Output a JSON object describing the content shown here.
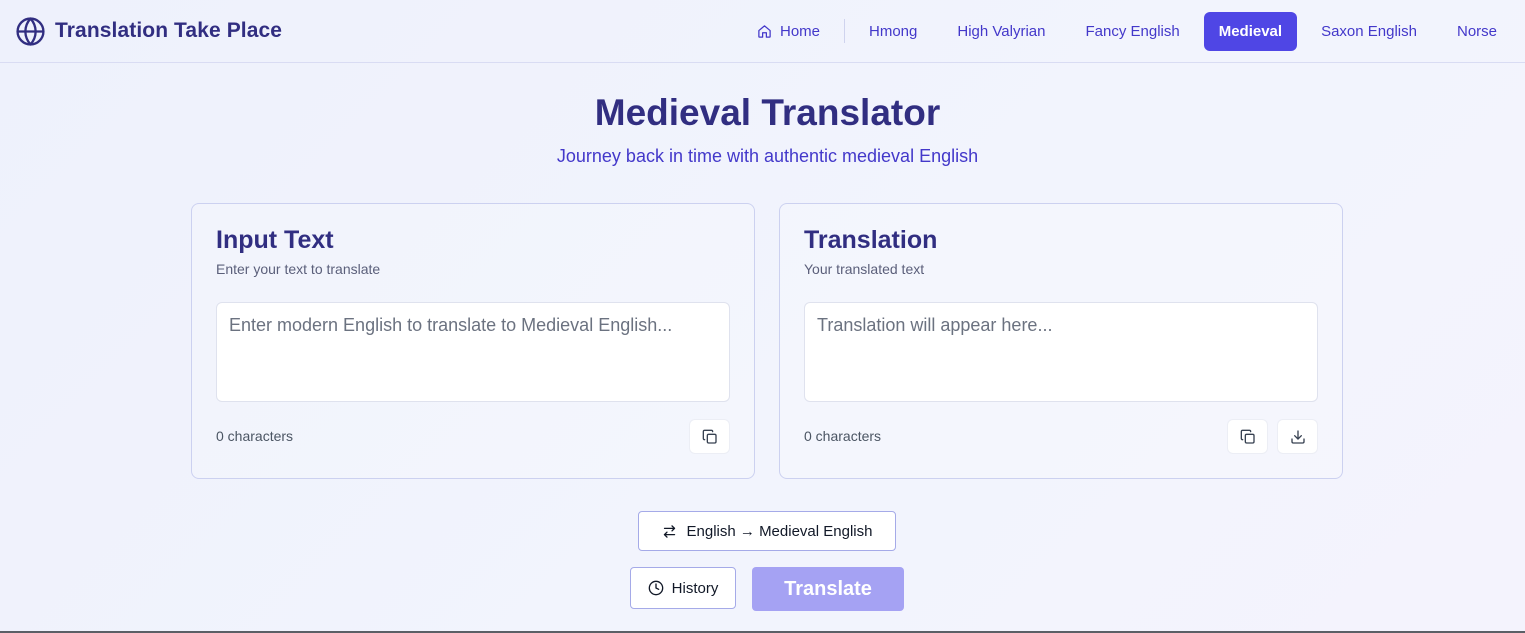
{
  "brand": {
    "title": "Translation Take Place",
    "icon": "globe-icon"
  },
  "nav": {
    "home_label": "Home",
    "items": [
      "Hmong",
      "High Valyrian",
      "Fancy English",
      "Medieval",
      "Saxon English",
      "Norse"
    ],
    "active": "Medieval"
  },
  "hero": {
    "title": "Medieval Translator",
    "subtitle": "Journey back in time with authentic medieval English"
  },
  "input_card": {
    "title": "Input Text",
    "subtitle": "Enter your text to translate",
    "placeholder": "Enter modern English to translate to Medieval English...",
    "value": "",
    "char_count": "0 characters"
  },
  "output_card": {
    "title": "Translation",
    "subtitle": "Your translated text",
    "placeholder": "Translation will appear here...",
    "char_count": "0 characters"
  },
  "controls": {
    "direction_label": "English → Medieval English",
    "history_label": "History",
    "translate_label": "Translate"
  },
  "colors": {
    "accent": "#4f46e5",
    "accent_disabled": "#a5a2f3",
    "title": "#312e81",
    "link": "#4338ca"
  }
}
